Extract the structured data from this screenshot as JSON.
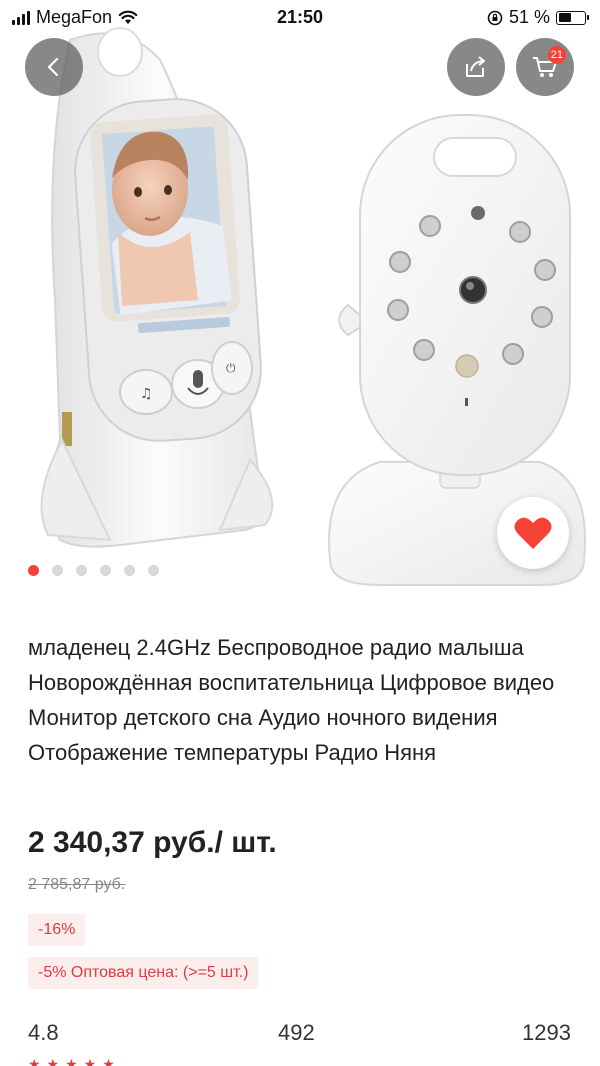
{
  "status_bar": {
    "carrier": "MegaFon",
    "time": "21:50",
    "battery": "51 %",
    "battery_level": 0.51
  },
  "hero": {
    "cart_count": "21",
    "carousel_total": 6,
    "carousel_active": 1
  },
  "product": {
    "title": "младенец 2.4GHz Беспроводное радио малыша Новорождённая воспитательница Цифровое видео Монитор детского сна Аудио ночного видения Отображение температуры Радио Няня",
    "price": "2 340,37 руб./ шт.",
    "old_price": "2 785,87 руб.",
    "discount_tag": "-16%",
    "wholesale_tag": "-5% Оптовая цена: (>=5 шт.)"
  },
  "stats": {
    "rating": "4.8",
    "orders": "492",
    "reviews": "1293",
    "stars": "★★★★★"
  },
  "colors": {
    "accent": "#f44336",
    "tag_bg": "#fdeeee",
    "tag_text": "#e23b3b"
  }
}
